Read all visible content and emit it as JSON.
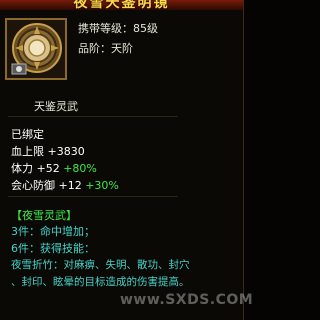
{
  "item": {
    "title": "夜雪天鉴明镜",
    "level_label": "携带等级：",
    "level_value": "85级",
    "rank_label": "品阶：",
    "rank_value": "天阶",
    "subtitle": "天鉴灵武",
    "icon": "mirror-shield-icon"
  },
  "stats": {
    "bound": "已绑定",
    "hp_label": "血上限",
    "hp_value": "+3830",
    "stamina_label": "体力",
    "stamina_value": "+52",
    "stamina_bonus": "+80%",
    "crit_def_label": "会心防御",
    "crit_def_value": "+12",
    "crit_def_bonus": "+30%"
  },
  "set": {
    "name": "【夜雪灵武】",
    "bonus3": "3件：命中增加；",
    "bonus6": "6件：获得技能：",
    "skill_line1": "夜雪折竹：对麻痹、失明、散功、封穴",
    "skill_line2": "、封印、眩晕的目标造成的伤害提高。"
  },
  "watermark": "www.SXDS.COM",
  "colors": {
    "title": "#ffd84a",
    "bonus_green": "#3ee84a",
    "set_teal": "#46d2c8"
  }
}
